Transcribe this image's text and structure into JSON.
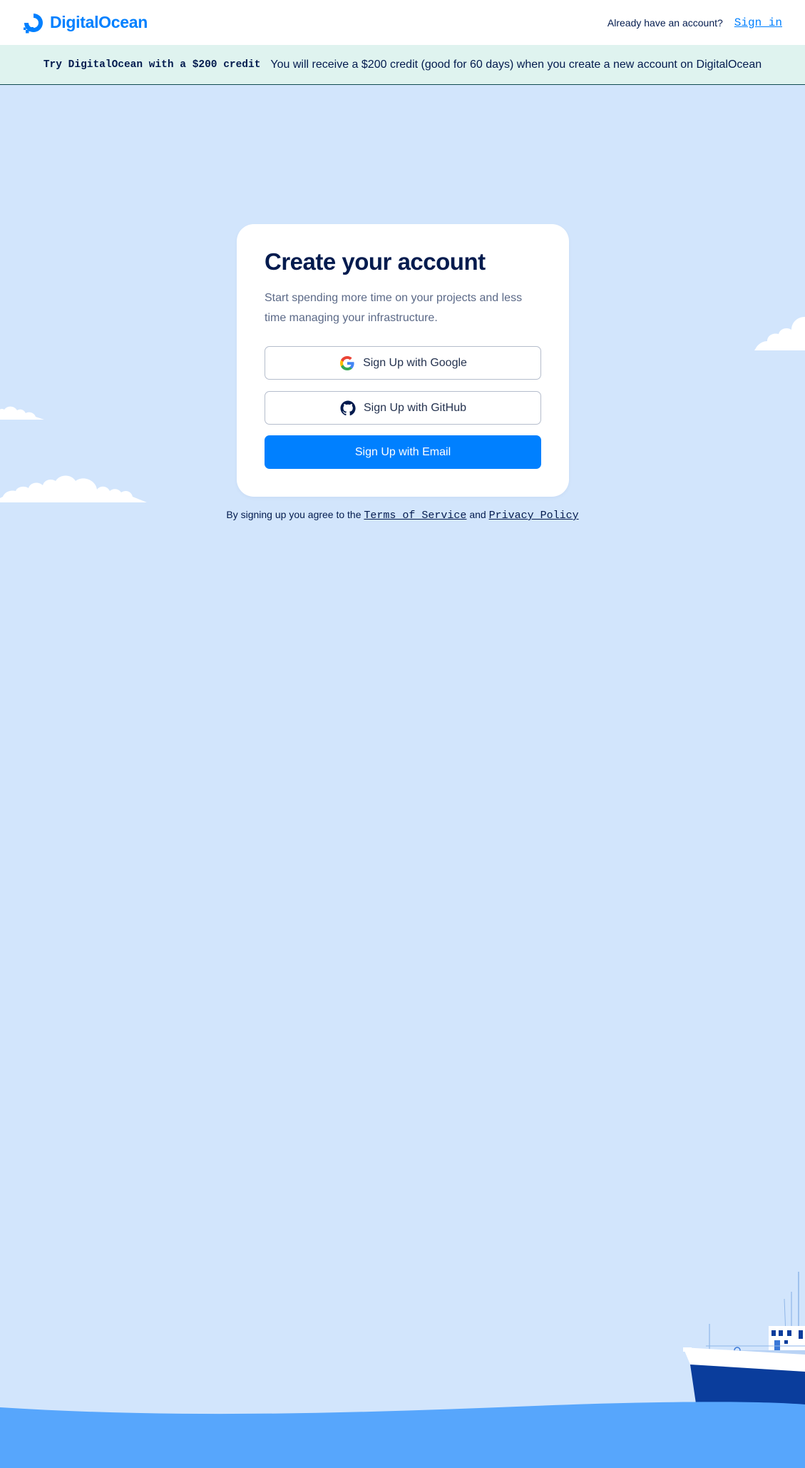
{
  "header": {
    "logo_text": "DigitalOcean",
    "already_text": "Already have an account?",
    "signin_label": "Sign in"
  },
  "promo": {
    "title": "Try DigitalOcean with a $200 credit",
    "text": "You will receive a $200 credit (good for 60 days) when you create a new account on DigitalOcean"
  },
  "card": {
    "title": "Create your account",
    "subtitle": "Start spending more time on your projects and less time managing your infrastructure.",
    "google_label": "Sign Up with Google",
    "github_label": "Sign Up with GitHub",
    "email_label": "Sign Up with Email"
  },
  "terms": {
    "prefix": "By signing up you agree to the",
    "tos_label": "Terms of Service",
    "and": "and",
    "privacy_label": "Privacy Policy"
  },
  "colors": {
    "brand": "#0080ff",
    "background": "#d2e5fc",
    "text_dark": "#031b4e",
    "ocean": "#57a6fc",
    "promo_bg": "#dff3ef"
  },
  "icons": [
    "digitalocean-logo-icon",
    "google-icon",
    "github-icon"
  ]
}
